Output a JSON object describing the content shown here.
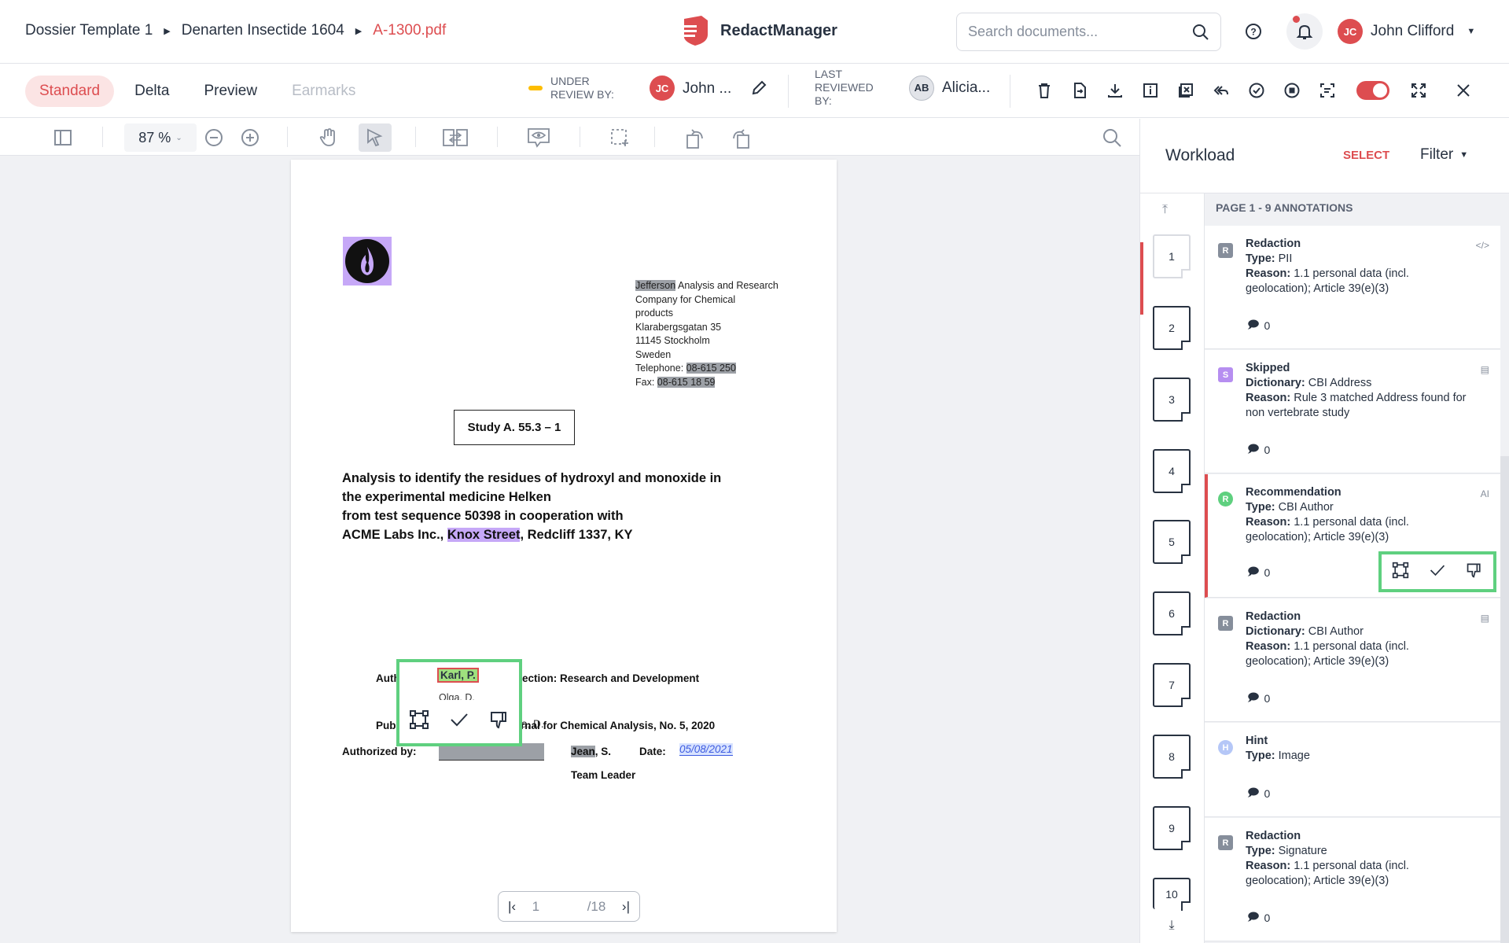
{
  "breadcrumb": {
    "items": [
      "Dossier Template 1",
      "Denarten Insectide 1604"
    ],
    "current": "A-1300.pdf"
  },
  "brand": {
    "name": "RedactManager"
  },
  "search": {
    "placeholder": "Search documents..."
  },
  "user": {
    "initials": "JC",
    "name": "John Clifford"
  },
  "views": [
    {
      "label": "Standard"
    },
    {
      "label": "Delta"
    },
    {
      "label": "Preview"
    },
    {
      "label": "Earmarks"
    }
  ],
  "review": {
    "under_review_label": "UNDER REVIEW BY:",
    "reviewer_initials": "JC",
    "reviewer_name": "John ...",
    "last_reviewed_label": "LAST REVIEWED BY:",
    "last_initials": "AB",
    "last_name": "Alicia..."
  },
  "viewer": {
    "zoom": "87 %"
  },
  "document": {
    "address": {
      "line1_hl": "Jefferson",
      "line1_rest": " Analysis and Research",
      "line2": "Company for Chemical",
      "line3": "products",
      "line4": "Klarabergsgatan 35",
      "line5": "11145 Stockholm",
      "line6": "Sweden",
      "tel_label": "Telephone: ",
      "tel": "08-615 250",
      "fax_label": "Fax: ",
      "fax": "08-615 18 59"
    },
    "study": "Study A. 55.3 – 1",
    "title_l1": "Analysis to identify the residues of hydroxyl and monoxide in",
    "title_l2": "the experimental medicine Helken",
    "title_l3": "from test sequence 50398 in cooperation with",
    "title_l4a": "ACME Labs Inc., ",
    "title_l4_hl": "Knox Street",
    "title_l4b": ", Redcliff 1337, KY",
    "authors_label": "Authors:",
    "author1": "Karl, P.",
    "author2": "Olga, D.",
    "section": "Section: Research and Development",
    "pub_prefix": "Pub",
    "pub_rest": "rnal for Chemical Analysis, No. 5, 2020",
    "authorized_label": "Authorized by:",
    "jean": "Jean",
    "jean_rest": ", S.",
    "date_label": "Date:",
    "date_val": "05/08/2021",
    "team_leader": "Team Leader"
  },
  "pager": {
    "current": "1",
    "total": "/18"
  },
  "panel": {
    "title": "Workload",
    "select": "SELECT",
    "filter": "Filter",
    "list_header": "PAGE 1 - 9 ANNOTATIONS",
    "pages": [
      "1",
      "2",
      "3",
      "4",
      "5",
      "6",
      "7",
      "8",
      "9",
      "10"
    ],
    "cards": [
      {
        "badge": "R",
        "badge_color": "#868e9b",
        "title": "Redaction",
        "l1k": "Type:",
        "l1v": " PII",
        "l2k": "Reason:",
        "l2v": " 1.1 personal data (incl. geolocation); Article 39(e)(3)",
        "comments": "0",
        "right": "</>"
      },
      {
        "badge": "S",
        "badge_color": "#b68ef0",
        "title": "Skipped",
        "l1k": "Dictionary:",
        "l1v": " CBI Address",
        "l2k": "Reason:",
        "l2v": " Rule 3 matched Address found for non vertebrate study",
        "comments": "0",
        "right": "▤"
      },
      {
        "badge": "R",
        "badge_color": "#5fd07f",
        "title": "Recommendation",
        "l1k": "Type:",
        "l1v": " CBI Author",
        "l2k": "Reason:",
        "l2v": " 1.1 personal data (incl. geolocation); Article 39(e)(3)",
        "comments": "0",
        "right": "AI"
      },
      {
        "badge": "R",
        "badge_color": "#868e9b",
        "title": "Redaction",
        "l1k": "Dictionary:",
        "l1v": " CBI Author",
        "l2k": "Reason:",
        "l2v": " 1.1 personal data (incl. geolocation); Article 39(e)(3)",
        "comments": "0",
        "right": "▤"
      },
      {
        "badge": "H",
        "badge_color": "#b5c7f7",
        "title": "Hint",
        "l1k": "Type:",
        "l1v": " Image",
        "l2k": "",
        "l2v": "",
        "comments": "0",
        "right": ""
      },
      {
        "badge": "R",
        "badge_color": "#868e9b",
        "title": "Redaction",
        "l1k": "Type:",
        "l1v": " Signature",
        "l2k": "Reason:",
        "l2v": " 1.1 personal data (incl. geolocation); Article 39(e)(3)",
        "comments": "0",
        "right": ""
      }
    ]
  },
  "colors": {
    "accent": "#dd4d50",
    "highlight_box": "#5fd07f"
  }
}
